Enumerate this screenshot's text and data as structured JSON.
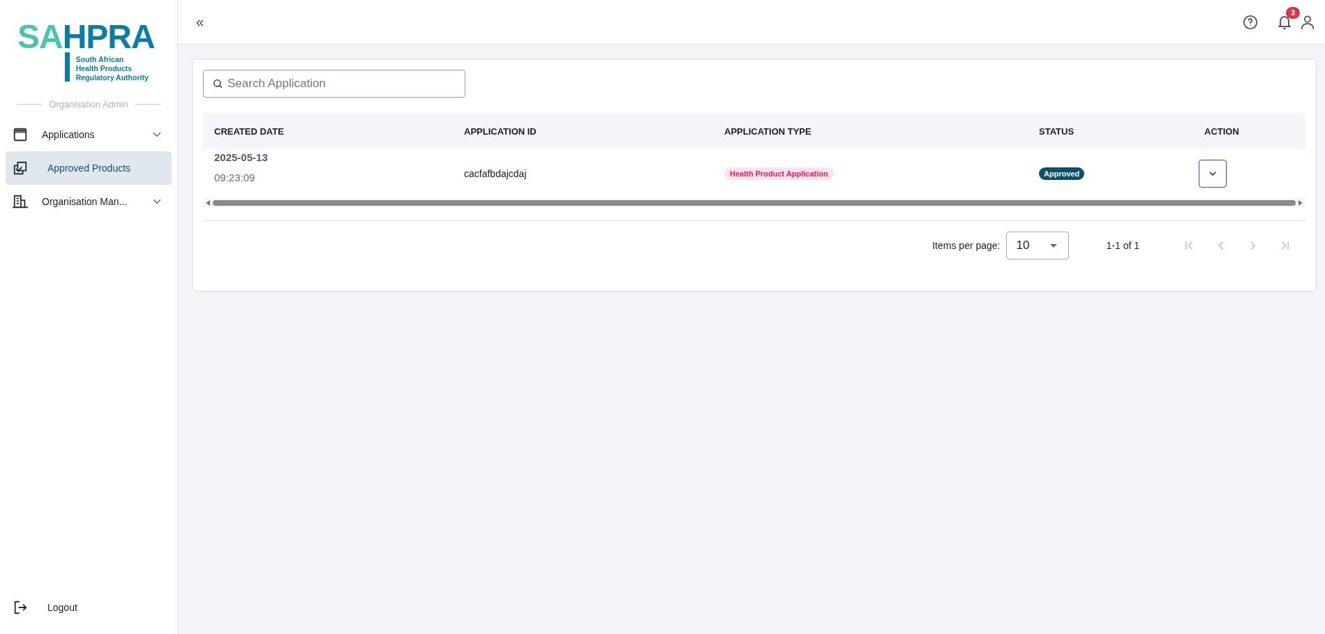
{
  "logo": {
    "mark_left": "SA",
    "mark_right": "HPRA",
    "subtitle_lines": [
      "South African",
      "Health Products",
      "Regulatory Authority"
    ]
  },
  "sidebar": {
    "section_label": "Organisation Admin",
    "items": [
      {
        "label": "Applications",
        "kind": "window",
        "expandable": true,
        "selected": false
      },
      {
        "label": "Approved Products",
        "kind": "approved",
        "expandable": false,
        "selected": true
      },
      {
        "label": "Organisation Man...",
        "kind": "building",
        "expandable": true,
        "selected": false
      }
    ],
    "logout": "Logout"
  },
  "header": {
    "collapse_glyph": "«",
    "notification_count": "3"
  },
  "search": {
    "placeholder": "Search Application"
  },
  "table": {
    "columns": [
      "CREATED DATE",
      "APPLICATION ID",
      "APPLICATION TYPE",
      "STATUS",
      "ACTION"
    ],
    "rows": [
      {
        "created_date": "2025-05-13",
        "created_time": "09:23:09",
        "application_id": "cacfafbdajcdaj",
        "application_type": "Health Product Application",
        "status": "Approved"
      }
    ]
  },
  "pagination": {
    "items_per_page_label": "Items per page:",
    "items_per_page": "10",
    "range": "1-1 of 1",
    "nav": [
      {
        "kind": "first",
        "disabled": true
      },
      {
        "kind": "previous",
        "disabled": true
      },
      {
        "kind": "next",
        "disabled": true
      },
      {
        "kind": "last",
        "disabled": true
      }
    ]
  }
}
